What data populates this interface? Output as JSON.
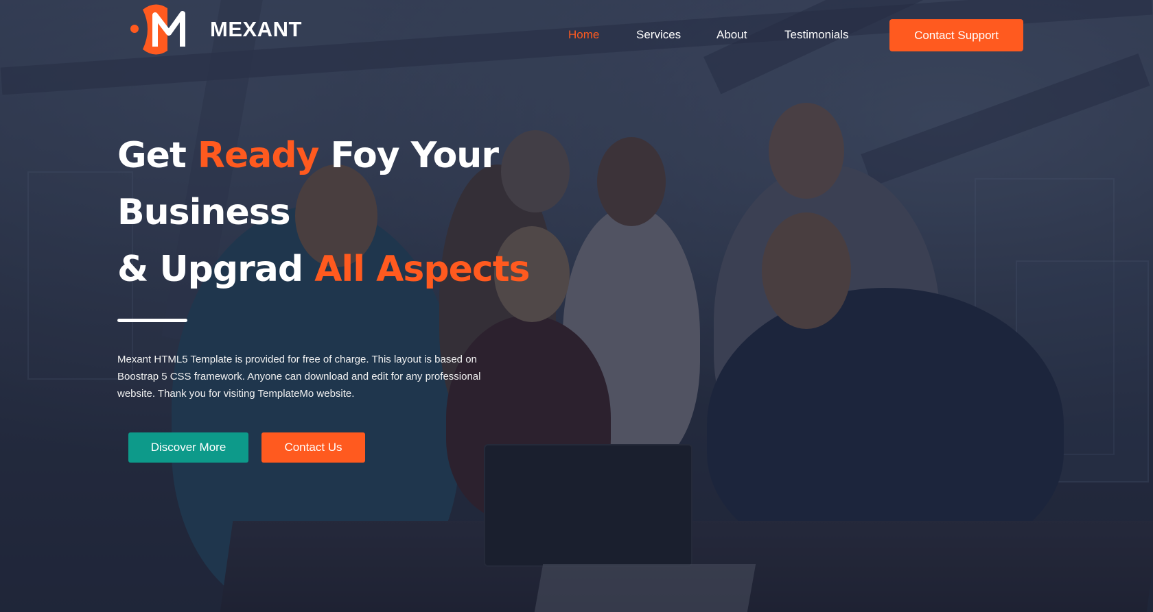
{
  "header": {
    "brand": "MEXANT",
    "nav": [
      {
        "label": "Home",
        "active": true
      },
      {
        "label": "Services",
        "active": false
      },
      {
        "label": "About",
        "active": false
      },
      {
        "label": "Testimonials",
        "active": false
      }
    ],
    "cta_label": "Contact Support"
  },
  "hero": {
    "title_line1_part1": "Get ",
    "title_line1_accent": "Ready",
    "title_line1_part2": " Foy Your",
    "title_line2": "Business",
    "title_line3_part1": "& Upgrad ",
    "title_line3_accent": "All Aspects",
    "description": "Mexant HTML5 Template is provided for free of charge. This layout is based on Boostrap 5 CSS framework. Anyone can download and edit for any professional website. Thank you for visiting TemplateMo website.",
    "primary_button": "Discover More",
    "secondary_button": "Contact Us"
  },
  "colors": {
    "accent": "#ff5a1f",
    "teal": "#0d9a8a",
    "overlay": "#141a2d"
  },
  "icons": {
    "logo": "mexant-m-logo"
  }
}
